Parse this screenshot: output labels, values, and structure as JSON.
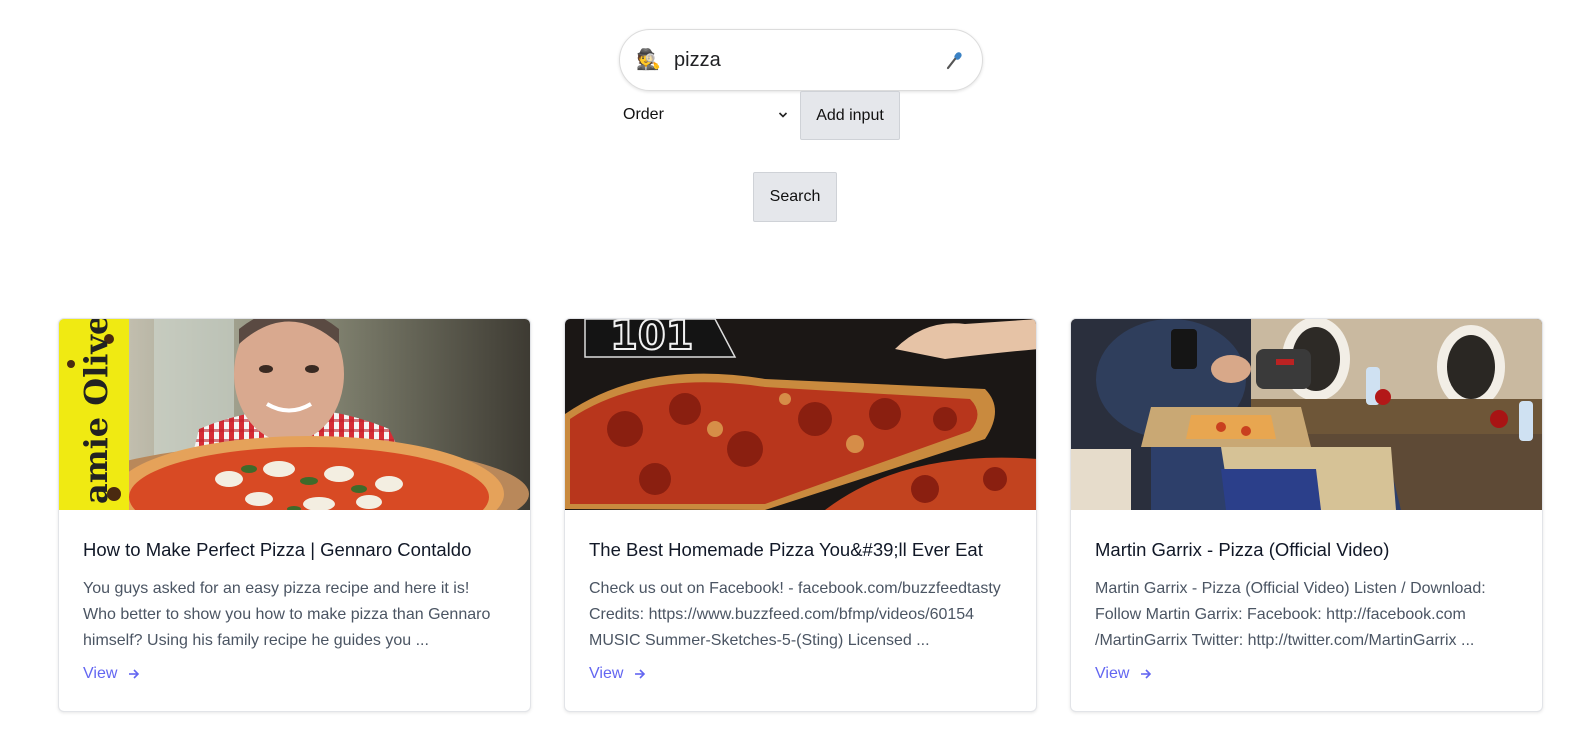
{
  "search": {
    "query": "pizza",
    "spy_icon": "🕵️",
    "mic_icon": "🎤"
  },
  "controls": {
    "order_label": "Order",
    "add_input_label": "Add input",
    "search_label": "Search"
  },
  "results": [
    {
      "title": "How to Make Perfect Pizza | Gennaro Contaldo",
      "description": "You guys asked for an easy pizza recipe and here it is! Who better to show you how to make pizza than Gennaro himself? Using his family recipe he guides you ...",
      "view_label": "View",
      "thumb_text": "amie Olive"
    },
    {
      "title": "The Best Homemade Pizza You&#39;ll Ever Eat",
      "description": "Check us out on Facebook! - facebook.com/buzzfeedtasty Credits: https://www.buzzfeed.com/bfmp/videos/60154 MUSIC Summer-Sketches-5-(Sting) Licensed ...",
      "view_label": "View",
      "thumb_text": "101"
    },
    {
      "title": "Martin Garrix - Pizza (Official Video)",
      "description": "Martin Garrix - Pizza (Official Video) Listen / Download: Follow Martin Garrix: Facebook: http://facebook.com /MartinGarrix Twitter: http://twitter.com/MartinGarrix ...",
      "view_label": "View"
    }
  ],
  "colors": {
    "link": "#6366f1",
    "button_bg": "#e5e7eb",
    "card_border": "#e2e4e8"
  }
}
